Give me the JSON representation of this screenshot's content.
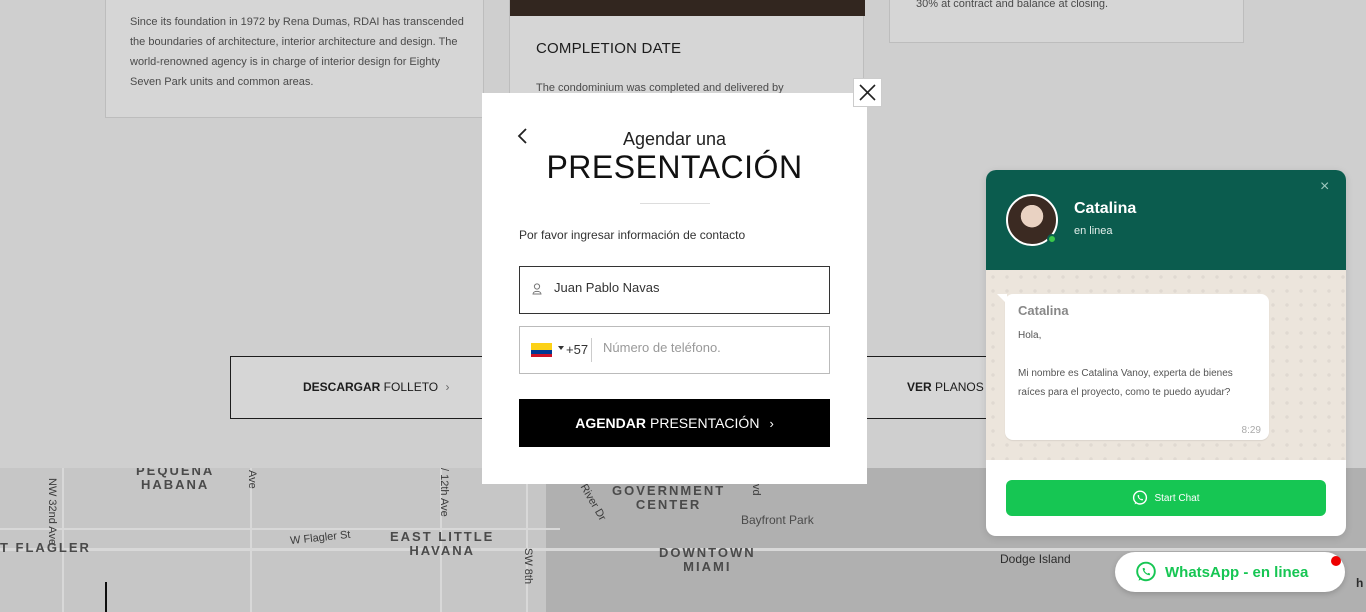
{
  "background": {
    "about_card": {
      "text": "Since its foundation in 1972 by Rena Dumas, RDAI has transcended the boundaries of architecture, interior architecture and design. The world-renowned agency is in charge of interior design for Eighty Seven Park units and common areas."
    },
    "completion_card": {
      "title": "COMPLETION DATE",
      "text": "The condominium was completed and delivered by"
    },
    "payment_card": {
      "text": "30% at contract and balance at closing."
    },
    "download_bar": {
      "left_bold": "DESCARGAR",
      "left_rest": " FOLLETO",
      "left_chevron": "›",
      "right_bold": "VER",
      "right_rest": " PLANOS D"
    },
    "map": {
      "labels": [
        {
          "text": "PEQUEÑA\nHABANA"
        },
        {
          "text": "GOVERNMENT\nCENTER"
        },
        {
          "text": "EAST LITTLE\nHAVANA"
        },
        {
          "text": "DOWNTOWN\nMIAMI"
        },
        {
          "text": "T FLAGLER"
        }
      ],
      "streets": [
        "NW 32nd Ave",
        "Ave",
        "/ 12th Ave",
        "River Dr",
        "vd",
        "W Flagler St",
        "SW 8th",
        "Bayfront Park",
        "Dodge Island",
        "h"
      ]
    }
  },
  "modal": {
    "subtitle": "Agendar una",
    "title": "PRESENTACIÓN",
    "instruction": "Por favor ingresar información de contacto",
    "name_value": "Juan Pablo Navas",
    "phone_dial_code": "+57",
    "phone_placeholder": "Número de teléfono.",
    "submit_bold": "AGENDAR",
    "submit_rest": "PRESENTACIÓN",
    "submit_chevron": "›"
  },
  "chat_widget": {
    "agent_name": "Catalina",
    "agent_status": "en linea",
    "close_glyph": "×",
    "message": {
      "sender": "Catalina",
      "text": "Hola,\n\nMi nombre es Catalina Vanoy, experta de bienes raíces para el proyecto, como te puedo ayudar?",
      "time": "8:29"
    },
    "start_chat_label": "Start Chat",
    "pill_label": "WhatsApp - en linea"
  },
  "colors": {
    "wa_header": "#0b5c4e",
    "wa_green": "#16c653",
    "modal_button": "#000000",
    "flag_yellow": "#fcd116",
    "flag_blue": "#003893",
    "flag_red": "#ce1126"
  }
}
